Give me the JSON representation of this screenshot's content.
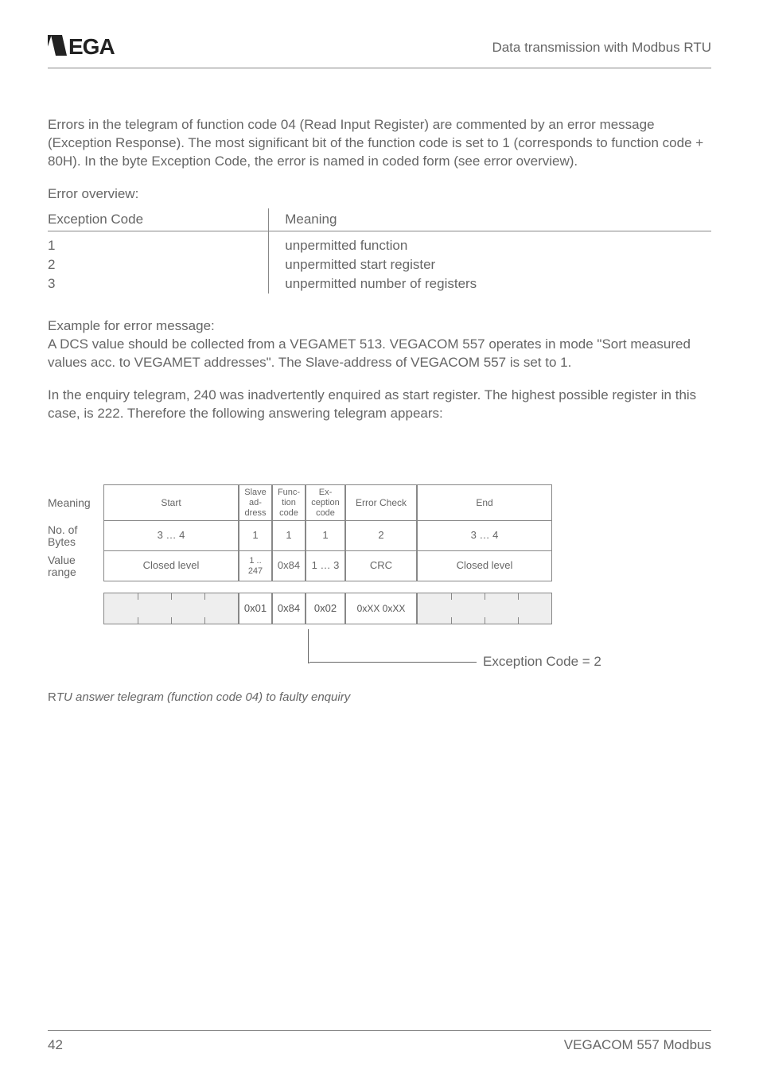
{
  "header": {
    "title": "Data transmission with Modbus RTU",
    "logo_name": "vega-logo"
  },
  "paragraphs": {
    "intro": "Errors in the telegram of function code 04 (Read Input Register) are commented by an error message (Exception Response). The most significant bit of the function code is set to 1 (corresponds to function code + 80H). In the byte Exception Code, the error is named in coded form (see error overview).",
    "error_overview_label": "Error overview:",
    "example_label": "Example for error message:",
    "example_body1": "A DCS value should be collected from a VEGAMET 513. VEGACOM 557 operates in mode \"Sort measured values acc. to VEGAMET addresses\". The Slave-address of VEGACOM 557 is set to 1.",
    "example_body2": "In the enquiry telegram, 240 was inadvertently enquired as start register. The highest possible register in this case, is 222. Therefore the following answering telegram appears:"
  },
  "error_table": {
    "headers": [
      "Exception Code",
      "Meaning"
    ],
    "rows": [
      {
        "code": "1",
        "meaning": "unpermitted function"
      },
      {
        "code": "2",
        "meaning": "unpermitted start register"
      },
      {
        "code": "3",
        "meaning": "unpermitted number of registers"
      }
    ]
  },
  "telegram": {
    "row_labels": {
      "meaning": "Meaning",
      "bytes": "No. of Bytes",
      "value": "Value range"
    },
    "columns": {
      "start": {
        "meaning": "Start",
        "bytes": "3 … 4",
        "value": "Closed level"
      },
      "slave": {
        "meaning": "Slave ad-dress",
        "bytes": "1",
        "value": "1 .. 247"
      },
      "func": {
        "meaning": "Func-tion code",
        "bytes": "1",
        "value": "0x84"
      },
      "ex": {
        "meaning": "Ex-ception code",
        "bytes": "1",
        "value": "1 … 3"
      },
      "err": {
        "meaning": "Error Check",
        "bytes": "2",
        "value": "CRC"
      },
      "end": {
        "meaning": "End",
        "bytes": "3 … 4",
        "value": "Closed level"
      }
    },
    "sample": {
      "slave": "0x01",
      "func": "0x84",
      "ex": "0x02",
      "err": "0xXX   0xXX"
    },
    "exception_caption": "Exception Code = 2"
  },
  "figure_caption": {
    "first_letter": "R",
    "rest": "TU answer telegram (function code 04) to faulty enquiry"
  },
  "footer": {
    "page": "42",
    "doc": "VEGACOM 557 Modbus"
  }
}
